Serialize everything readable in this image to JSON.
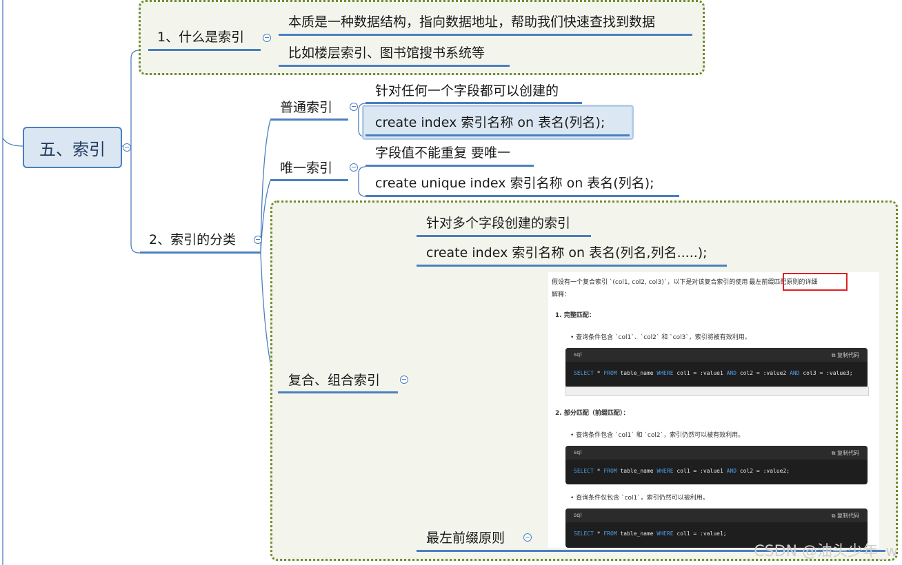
{
  "root": {
    "label": "五、索引"
  },
  "branch1": {
    "label": "1、什么是索引",
    "children": [
      "本质是一种数据结构，指向数据地址，帮助我们快速查找到数据",
      "比如楼层索引、图书馆搜书系统等"
    ]
  },
  "branch2": {
    "label": "2、索引的分类",
    "normal": {
      "label": "普通索引",
      "children": [
        "针对任何一个字段都可以创建的",
        "create index 索引名称  on 表名(列名);"
      ]
    },
    "unique": {
      "label": "唯一索引",
      "children": [
        "字段值不能重复  要唯一",
        "create unique index 索引名称  on 表名(列名);"
      ]
    },
    "composite": {
      "label": "复合、组合索引",
      "children": [
        "针对多个字段创建的索引",
        "create index 索引名称  on 表名(列名,列名.....);"
      ],
      "leftmost": {
        "label": "最左前缀原则"
      }
    }
  },
  "doc": {
    "intro_line1": "假设有一个复合索引 `(col1, col2, col3)`，以下是对该复合索引的使用",
    "intro_highlight": "最左前缀匹配原则",
    "intro_tail": "的详细",
    "intro_line2": "解释：",
    "sec1_title": "1. 完整匹配：",
    "sec1_bullet": "查询条件包含 `col1`、`col2` 和 `col3`，索引将被有效利用。",
    "sec2_title": "2. 部分匹配（前缀匹配）：",
    "sec2_bullet1": "查询条件包含 `col1` 和 `col2`，索引仍然可以被有效利用。",
    "sec2_bullet2": "查询条件仅包含 `col1`，索引仍然可以被利用。",
    "code_lang": "sql",
    "code_copy": "复制代码",
    "code1": {
      "kw1": "SELECT",
      "t1": " * ",
      "kw2": "FROM",
      "t2": " table_name ",
      "kw3": "WHERE",
      "t3": " col1 = :value1 ",
      "kw4": "AND",
      "t4": " col2 = :value2 ",
      "kw5": "AND",
      "t5": " col3 = :value3;"
    },
    "code2": {
      "kw1": "SELECT",
      "t1": " * ",
      "kw2": "FROM",
      "t2": " table_name ",
      "kw3": "WHERE",
      "t3": " col1 = :value1 ",
      "kw4": "AND",
      "t4": " col2 = :value2;"
    },
    "code3": {
      "kw1": "SELECT",
      "t1": " * ",
      "kw2": "FROM",
      "t2": " table_name ",
      "kw3": "WHERE",
      "t3": " col1 = :value1;"
    }
  },
  "watermark": "CSDN @油头少年_w",
  "colors": {
    "branch": "#4a7ec0",
    "group_border": "#6e8b2c",
    "highlight": "#e02020"
  }
}
